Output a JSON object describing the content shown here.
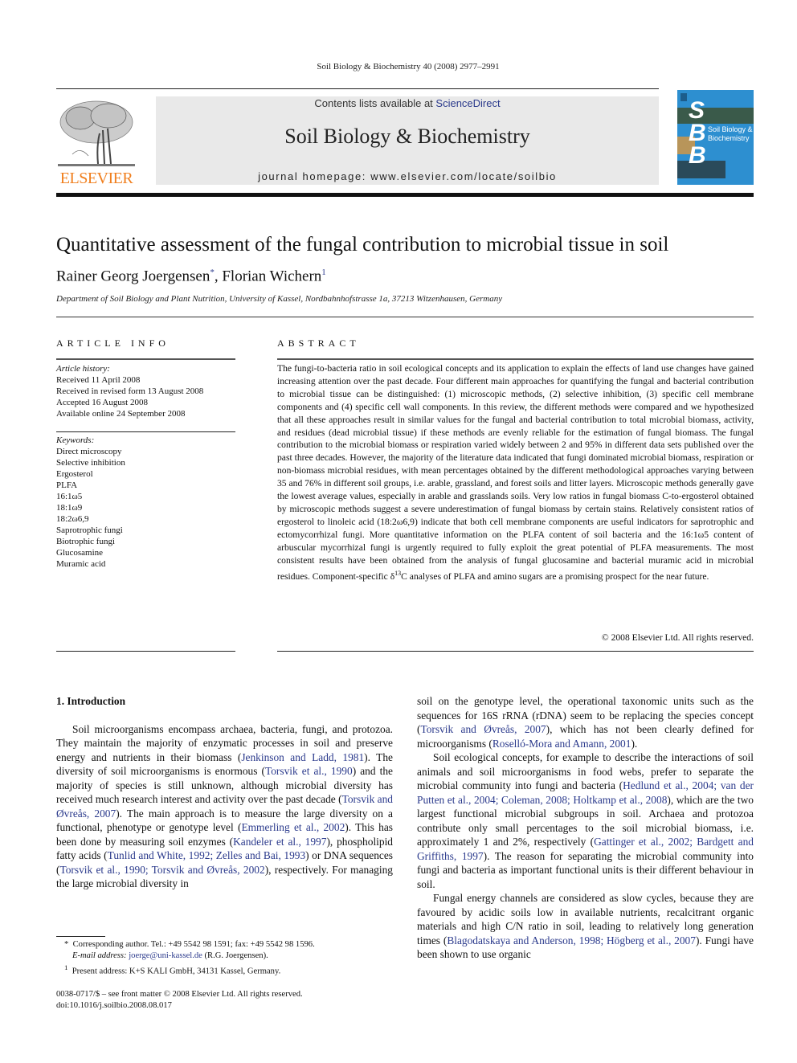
{
  "running_header": "Soil Biology & Biochemistry 40 (2008) 2977–2991",
  "banner": {
    "contents_prefix": "Contents lists available at ",
    "contents_link": "ScienceDirect",
    "journal_title": "Soil Biology & Biochemistry",
    "homepage": "journal homepage: www.elsevier.com/locate/soilbio",
    "publisher_logo_text": "ELSEVIER",
    "cover_letters": [
      "S",
      "B",
      "B"
    ],
    "cover_title_line1": "Soil Biology &",
    "cover_title_line2": "Biochemistry"
  },
  "article": {
    "title": "Quantitative assessment of the fungal contribution to microbial tissue in soil",
    "author1": "Rainer Georg Joergensen",
    "author1_mark": "*",
    "author_sep": ", ",
    "author2": "Florian Wichern",
    "author2_mark": "1",
    "affiliation": "Department of Soil Biology and Plant Nutrition, University of Kassel, Nordbahnhofstrasse 1a, 37213 Witzenhausen, Germany"
  },
  "article_info": {
    "heading": "ARTICLE INFO",
    "history_label": "Article history:",
    "history": [
      "Received 11 April 2008",
      "Received in revised form 13 August 2008",
      "Accepted 16 August 2008",
      "Available online 24 September 2008"
    ],
    "keywords_label": "Keywords:",
    "keywords": [
      "Direct microscopy",
      "Selective inhibition",
      "Ergosterol",
      "PLFA",
      "16:1ω5",
      "18:1ω9",
      "18:2ω6,9",
      "Saprotrophic fungi",
      "Biotrophic fungi",
      "Glucosamine",
      "Muramic acid"
    ]
  },
  "abstract": {
    "heading": "ABSTRACT",
    "text_before_sup": "The fungi-to-bacteria ratio in soil ecological concepts and its application to explain the effects of land use changes have gained increasing attention over the past decade. Four different main approaches for quantifying the fungal and bacterial contribution to microbial tissue can be distinguished: (1) microscopic methods, (2) selective inhibition, (3) specific cell membrane components and (4) specific cell wall components. In this review, the different methods were compared and we hypothesized that all these approaches result in similar values for the fungal and bacterial contribution to total microbial biomass, activity, and residues (dead microbial tissue) if these methods are evenly reliable for the estimation of fungal biomass. The fungal contribution to the microbial biomass or respiration varied widely between 2 and 95% in different data sets published over the past three decades. However, the majority of the literature data indicated that fungi dominated microbial biomass, respiration or non-biomass microbial residues, with mean percentages obtained by the different methodological approaches varying between 35 and 76% in different soil groups, i.e. arable, grassland, and forest soils and litter layers. Microscopic methods generally gave the lowest average values, especially in arable and grasslands soils. Very low ratios in fungal biomass C-to-ergosterol obtained by microscopic methods suggest a severe underestimation of fungal biomass by certain stains. Relatively consistent ratios of ergosterol to linoleic acid (18:2ω6,9) indicate that both cell membrane components are useful indicators for saprotrophic and ectomycorrhizal fungi. More quantitative information on the PLFA content of soil bacteria and the 16:1ω5 content of arbuscular mycorrhizal fungi is urgently required to fully exploit the great potential of PLFA measurements. The most consistent results have been obtained from the analysis of fungal glucosamine and bacterial muramic acid in microbial residues. Component-specific δ",
    "sup": "13",
    "text_after_sup": "C analyses of PLFA and amino sugars are a promising prospect for the near future.",
    "copyright": "© 2008 Elsevier Ltd. All rights reserved."
  },
  "body": {
    "section_heading": "1.  Introduction",
    "left_col": [
      {
        "t": "Soil microorganisms encompass archaea, bacteria, fungi, and protozoa. They maintain the majority of enzymatic processes in soil and preserve energy and nutrients in their biomass ("
      },
      {
        "r": "Jenkinson and Ladd, 1981"
      },
      {
        "t": "). The diversity of soil microorganisms is enormous ("
      },
      {
        "r": "Torsvik et al., 1990"
      },
      {
        "t": ") and the majority of species is still unknown, although microbial diversity has received much research interest and activity over the past decade ("
      },
      {
        "r": "Torsvik and Øvreås, 2007"
      },
      {
        "t": "). The main approach is to measure the large diversity on a functional, phenotype or genotype level ("
      },
      {
        "r": "Emmerling et al., 2002"
      },
      {
        "t": "). This has been done by measuring soil enzymes ("
      },
      {
        "r": "Kandeler et al., 1997"
      },
      {
        "t": "), phospholipid fatty acids ("
      },
      {
        "r": "Tunlid and White, 1992; Zelles and Bai, 1993"
      },
      {
        "t": ") or DNA sequences ("
      },
      {
        "r": "Torsvik et al., 1990; Torsvik and Øvreås, 2002"
      },
      {
        "t": "), respectively. For managing the large microbial diversity in"
      }
    ],
    "right_p1": [
      {
        "t": "soil on the genotype level, the operational taxonomic units such as the sequences for 16S rRNA (rDNA) seem to be replacing the species concept ("
      },
      {
        "r": "Torsvik and Øvreås, 2007"
      },
      {
        "t": "), which has not been clearly defined for microorganisms ("
      },
      {
        "r": "Roselló-Mora and Amann, 2001"
      },
      {
        "t": ")."
      }
    ],
    "right_p2": [
      {
        "t": "Soil ecological concepts, for example to describe the interactions of soil animals and soil microorganisms in food webs, prefer to separate the microbial community into fungi and bacteria ("
      },
      {
        "r": "Hedlund et al., 2004; van der Putten et al., 2004; Coleman, 2008; Holtkamp et al., 2008"
      },
      {
        "t": "), which are the two largest functional microbial subgroups in soil. Archaea and protozoa contribute only small percentages to the soil microbial biomass, i.e. approximately 1 and 2%, respectively ("
      },
      {
        "r": "Gattinger et al., 2002; Bardgett and Griffiths, 1997"
      },
      {
        "t": "). The reason for separating the microbial community into fungi and bacteria as important functional units is their different behaviour in soil."
      }
    ],
    "right_p3": [
      {
        "t": "Fungal energy channels are considered as slow cycles, because they are favoured by acidic soils low in available nutrients, recalcitrant organic materials and high C/N ratio in soil, leading to relatively long generation times ("
      },
      {
        "r": "Blagodatskaya and Anderson, 1998; Högberg et al., 2007"
      },
      {
        "t": "). Fungi have been shown to use organic"
      }
    ]
  },
  "footnotes": {
    "corr_mark": "*",
    "corr_text": "Corresponding author. Tel.: +49 5542 98 1591; fax: +49 5542 98 1596.",
    "email_label": "E-mail address: ",
    "email": "joerge@uni-kassel.de",
    "email_suffix": " (R.G. Joergensen).",
    "present_mark": "1",
    "present_text": "Present address: K+S KALI GmbH, 34131 Kassel, Germany.",
    "issn": "0038-0717/$ – see front matter © 2008 Elsevier Ltd. All rights reserved.",
    "doi": "doi:10.1016/j.soilbio.2008.08.017"
  }
}
